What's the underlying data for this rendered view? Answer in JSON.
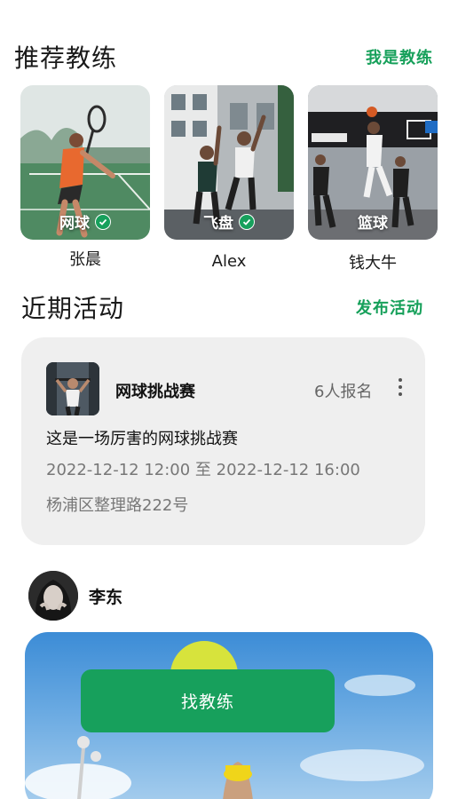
{
  "coaches_section": {
    "title": "推荐教练",
    "link": "我是教练",
    "coaches": [
      {
        "name": "张晨",
        "sport": "网球",
        "verified": true
      },
      {
        "name": "Alex",
        "sport": "飞盘",
        "verified": true
      },
      {
        "name": "钱大牛",
        "sport": "篮球",
        "verified": false
      }
    ]
  },
  "activities_section": {
    "title": "近期活动",
    "link": "发布活动",
    "activity": {
      "name": "网球挑战赛",
      "count": "6人报名",
      "description": "这是一场厉害的网球挑战赛",
      "time": "2022-12-12 12:00 至 2022-12-12 16:00",
      "location": "杨浦区整理路222号"
    }
  },
  "post": {
    "user": "李东",
    "button_label": "找教练"
  },
  "colors": {
    "accent": "#16a05a",
    "card_bg": "#efefef"
  }
}
